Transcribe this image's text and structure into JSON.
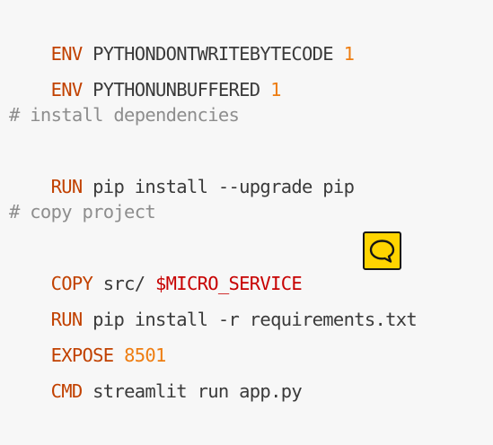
{
  "lines": [
    {
      "keyword": "ENV",
      "text": " PYTHONDONTWRITEBYTECODE ",
      "value": "1"
    },
    {
      "keyword": "ENV",
      "text": " PYTHONUNBUFFERED ",
      "value": "1"
    },
    {
      "comment": "# install dependencies"
    },
    {
      "keyword": "RUN",
      "text": " pip install --upgrade pip"
    },
    {
      "comment": "# copy project"
    },
    {
      "keyword": "COPY",
      "text": " src/ ",
      "variable": "$MICRO_SERVICE"
    },
    {
      "keyword": "RUN",
      "text": " pip install -r requirements.txt"
    },
    {
      "keyword": "EXPOSE",
      "text": " ",
      "value": "8501"
    },
    {
      "keyword": "CMD",
      "text": " streamlit run app.py"
    }
  ],
  "icons": {
    "comment_button": "speech-bubble-icon"
  },
  "colors": {
    "keyword": "#c14100",
    "number": "#ee7d11",
    "comment": "#8d8d8d",
    "variable": "#c70000",
    "text": "#3a3a3a",
    "background": "#f7f7f7",
    "comment_button": "#ffd400"
  }
}
